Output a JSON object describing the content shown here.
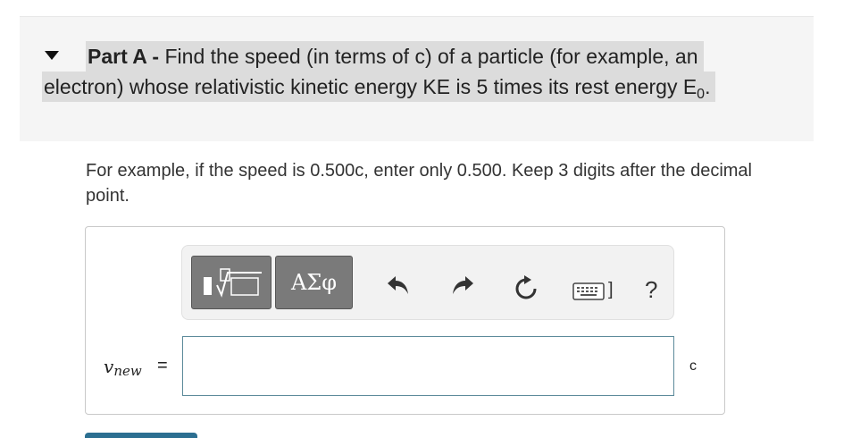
{
  "part": {
    "label": "Part A",
    "separator": " - ",
    "question_line1": "Find the speed (in terms of c) of a particle (for example, an",
    "question_line2": "electron) whose relativistic kinetic energy KE is 5 times its rest energy E",
    "question_subscript": "0",
    "question_end": "."
  },
  "instructions": "For example, if the speed is 0.500c, enter only 0.500. Keep 3 digits after the decimal point.",
  "toolbar": {
    "greek_label": "ΑΣφ",
    "keyboard_bracket": "]",
    "help_label": "?"
  },
  "answer": {
    "variable": "v",
    "variable_subscript": "new",
    "equals": "=",
    "value": "",
    "unit": "c"
  },
  "colors": {
    "header_bg": "#f5f5f5",
    "highlight_bg": "#dcdcdc",
    "toolbar_btn": "#7a7a7a",
    "input_border": "#5c8a9a",
    "submit_button": "#2c6f91"
  }
}
